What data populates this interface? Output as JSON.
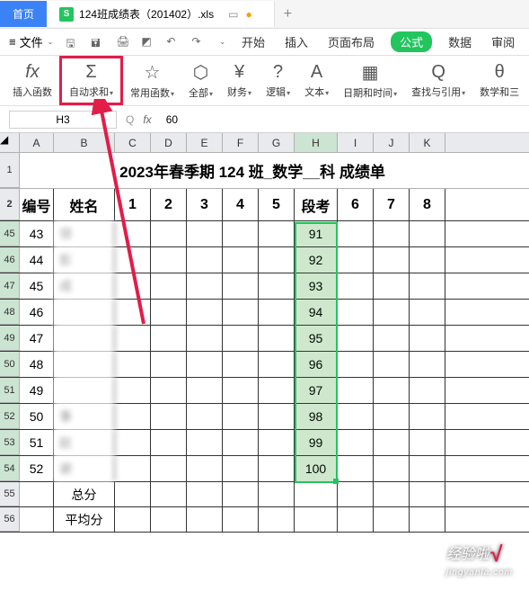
{
  "tabs": {
    "home": "首页",
    "file_name": "124班成绩表（201402）.xls",
    "file_indicator": "●"
  },
  "file_menu": "文件",
  "menu": {
    "start": "开始",
    "insert": "插入",
    "layout": "页面布局",
    "formula": "公式",
    "data": "数据",
    "review": "审阅"
  },
  "ribbon": {
    "insert_fn": "插入函数",
    "auto_sum": "自动求和",
    "common_fn": "常用函数",
    "all": "全部",
    "finance": "财务",
    "logic": "逻辑",
    "text": "文本",
    "datetime": "日期和时间",
    "lookup": "查找与引用",
    "math": "数学和三"
  },
  "name_box": "H3",
  "formula_value": "60",
  "columns": [
    "A",
    "B",
    "C",
    "D",
    "E",
    "F",
    "G",
    "H",
    "I",
    "J",
    "K"
  ],
  "title": "2023年春季期 124 班_数学__科 成绩单",
  "headers": {
    "id": "编号",
    "name": "姓名",
    "exam": "段考"
  },
  "header_nums": [
    "1",
    "2",
    "3",
    "4",
    "5",
    "6",
    "7",
    "8"
  ],
  "row_labels": [
    "1",
    "2",
    "45",
    "46",
    "47",
    "48",
    "49",
    "50",
    "51",
    "52",
    "53",
    "54",
    "55",
    "56"
  ],
  "data_rows": [
    {
      "id": "43",
      "name": "领",
      "score": "91"
    },
    {
      "id": "44",
      "name": "彭",
      "score": "92"
    },
    {
      "id": "45",
      "name": "成",
      "score": "93"
    },
    {
      "id": "46",
      "name": "",
      "score": "94"
    },
    {
      "id": "47",
      "name": "",
      "score": "95"
    },
    {
      "id": "48",
      "name": "",
      "score": "96"
    },
    {
      "id": "49",
      "name": "",
      "score": "97"
    },
    {
      "id": "50",
      "name": "事",
      "score": "98"
    },
    {
      "id": "51",
      "name": "赵",
      "score": "99"
    },
    {
      "id": "52",
      "name": "谢",
      "score": "100"
    }
  ],
  "summary": {
    "total": "总分",
    "avg": "平均分"
  },
  "watermark": {
    "main": "经验啦",
    "sub": "jingyanla.com"
  }
}
